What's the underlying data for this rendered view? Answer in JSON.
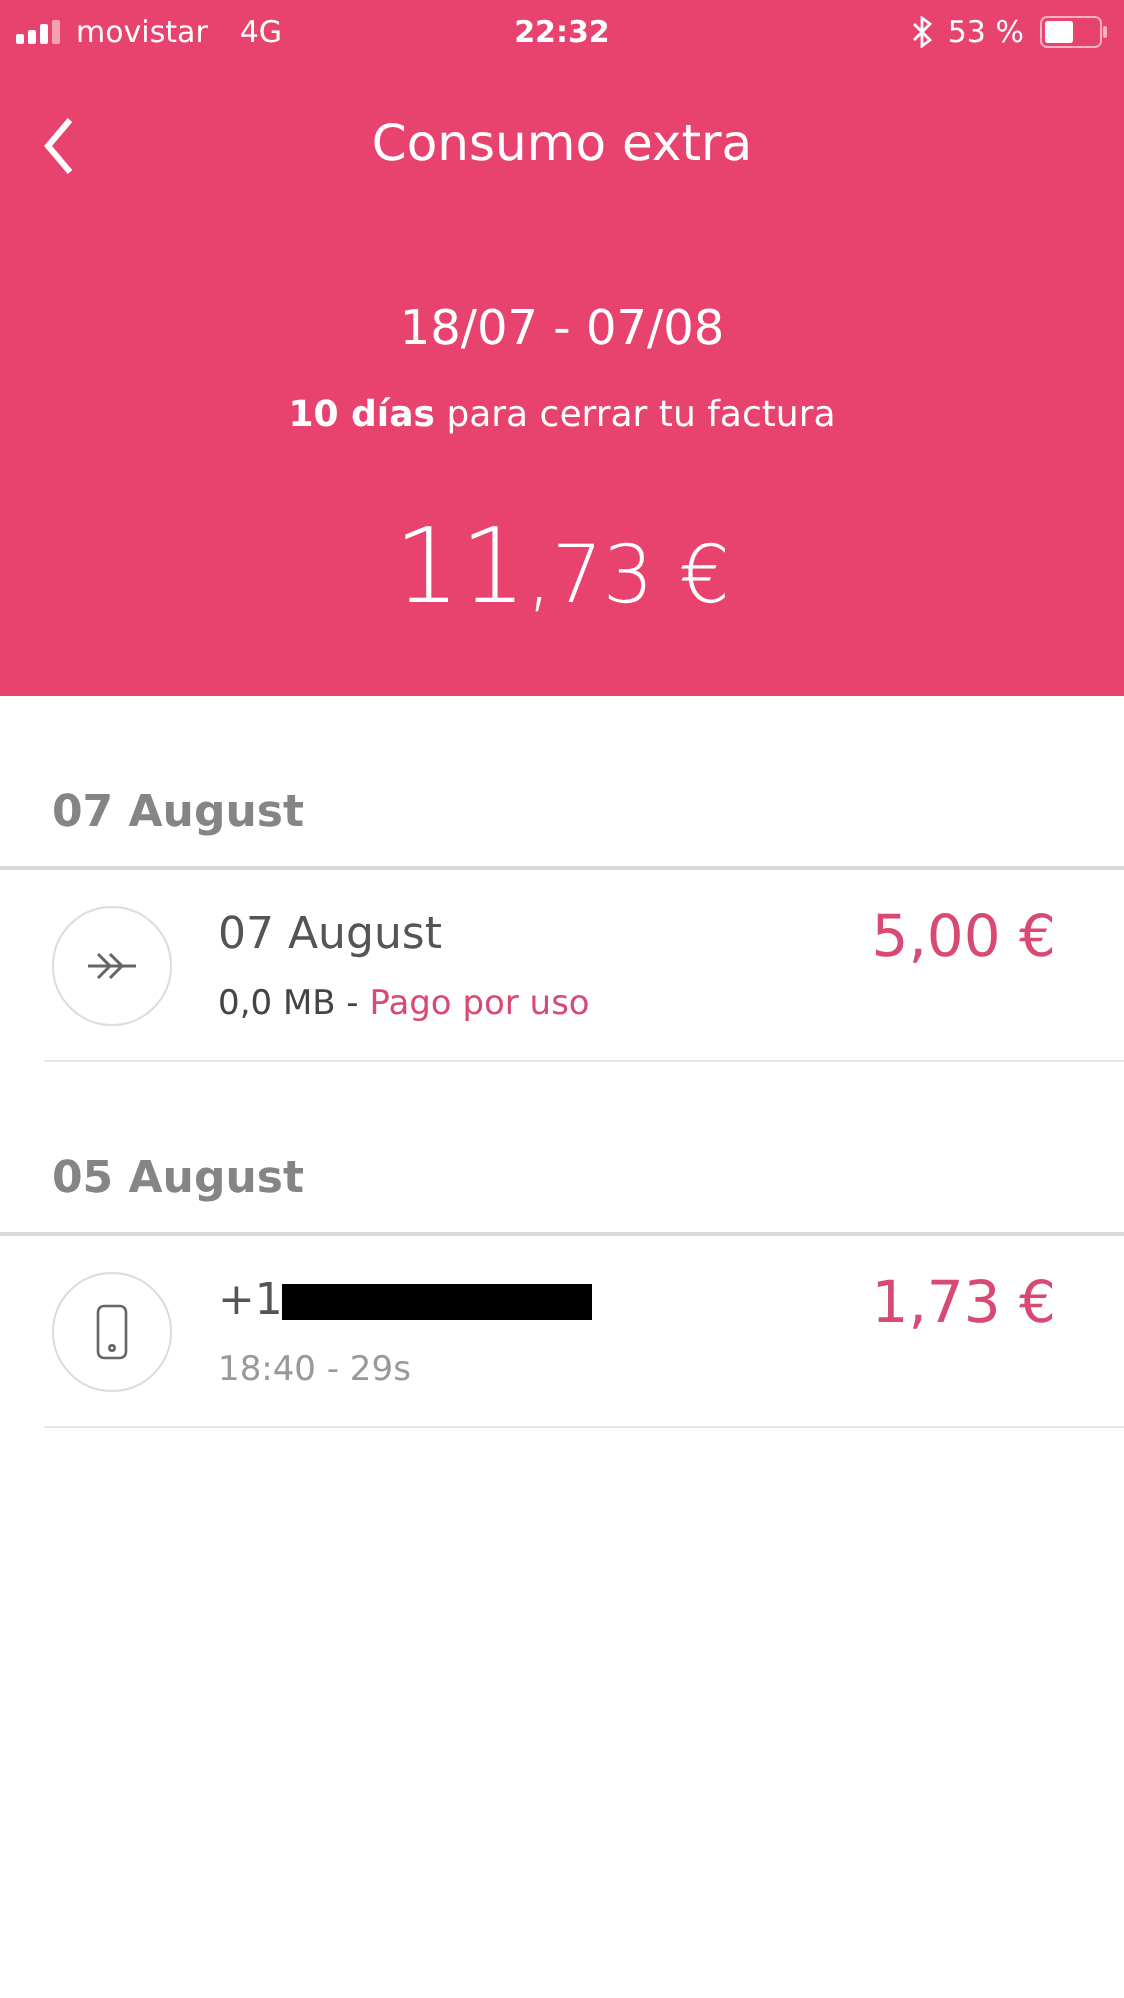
{
  "status_bar": {
    "carrier": "movistar",
    "network": "4G",
    "time": "22:32",
    "battery": "53 %"
  },
  "header": {
    "title": "Consumo extra",
    "period": "18/07 - 07/08",
    "deadline": "**10 días** para cerrar tu factura",
    "amount_integer": "11",
    "amount_rest": ",73 €"
  },
  "sections": [
    {
      "date": "07 August",
      "items": [
        {
          "kind": "data",
          "title": "07 August",
          "detail": "0,0 MB - ",
          "link": "Pago por uso",
          "amount": "5,00 €"
        }
      ]
    },
    {
      "date": "05 August",
      "items": [
        {
          "kind": "call",
          "title": "+1",
          "redacted": true,
          "detail": "18:40 - 29s",
          "amount": "1,73 €"
        }
      ]
    }
  ]
}
